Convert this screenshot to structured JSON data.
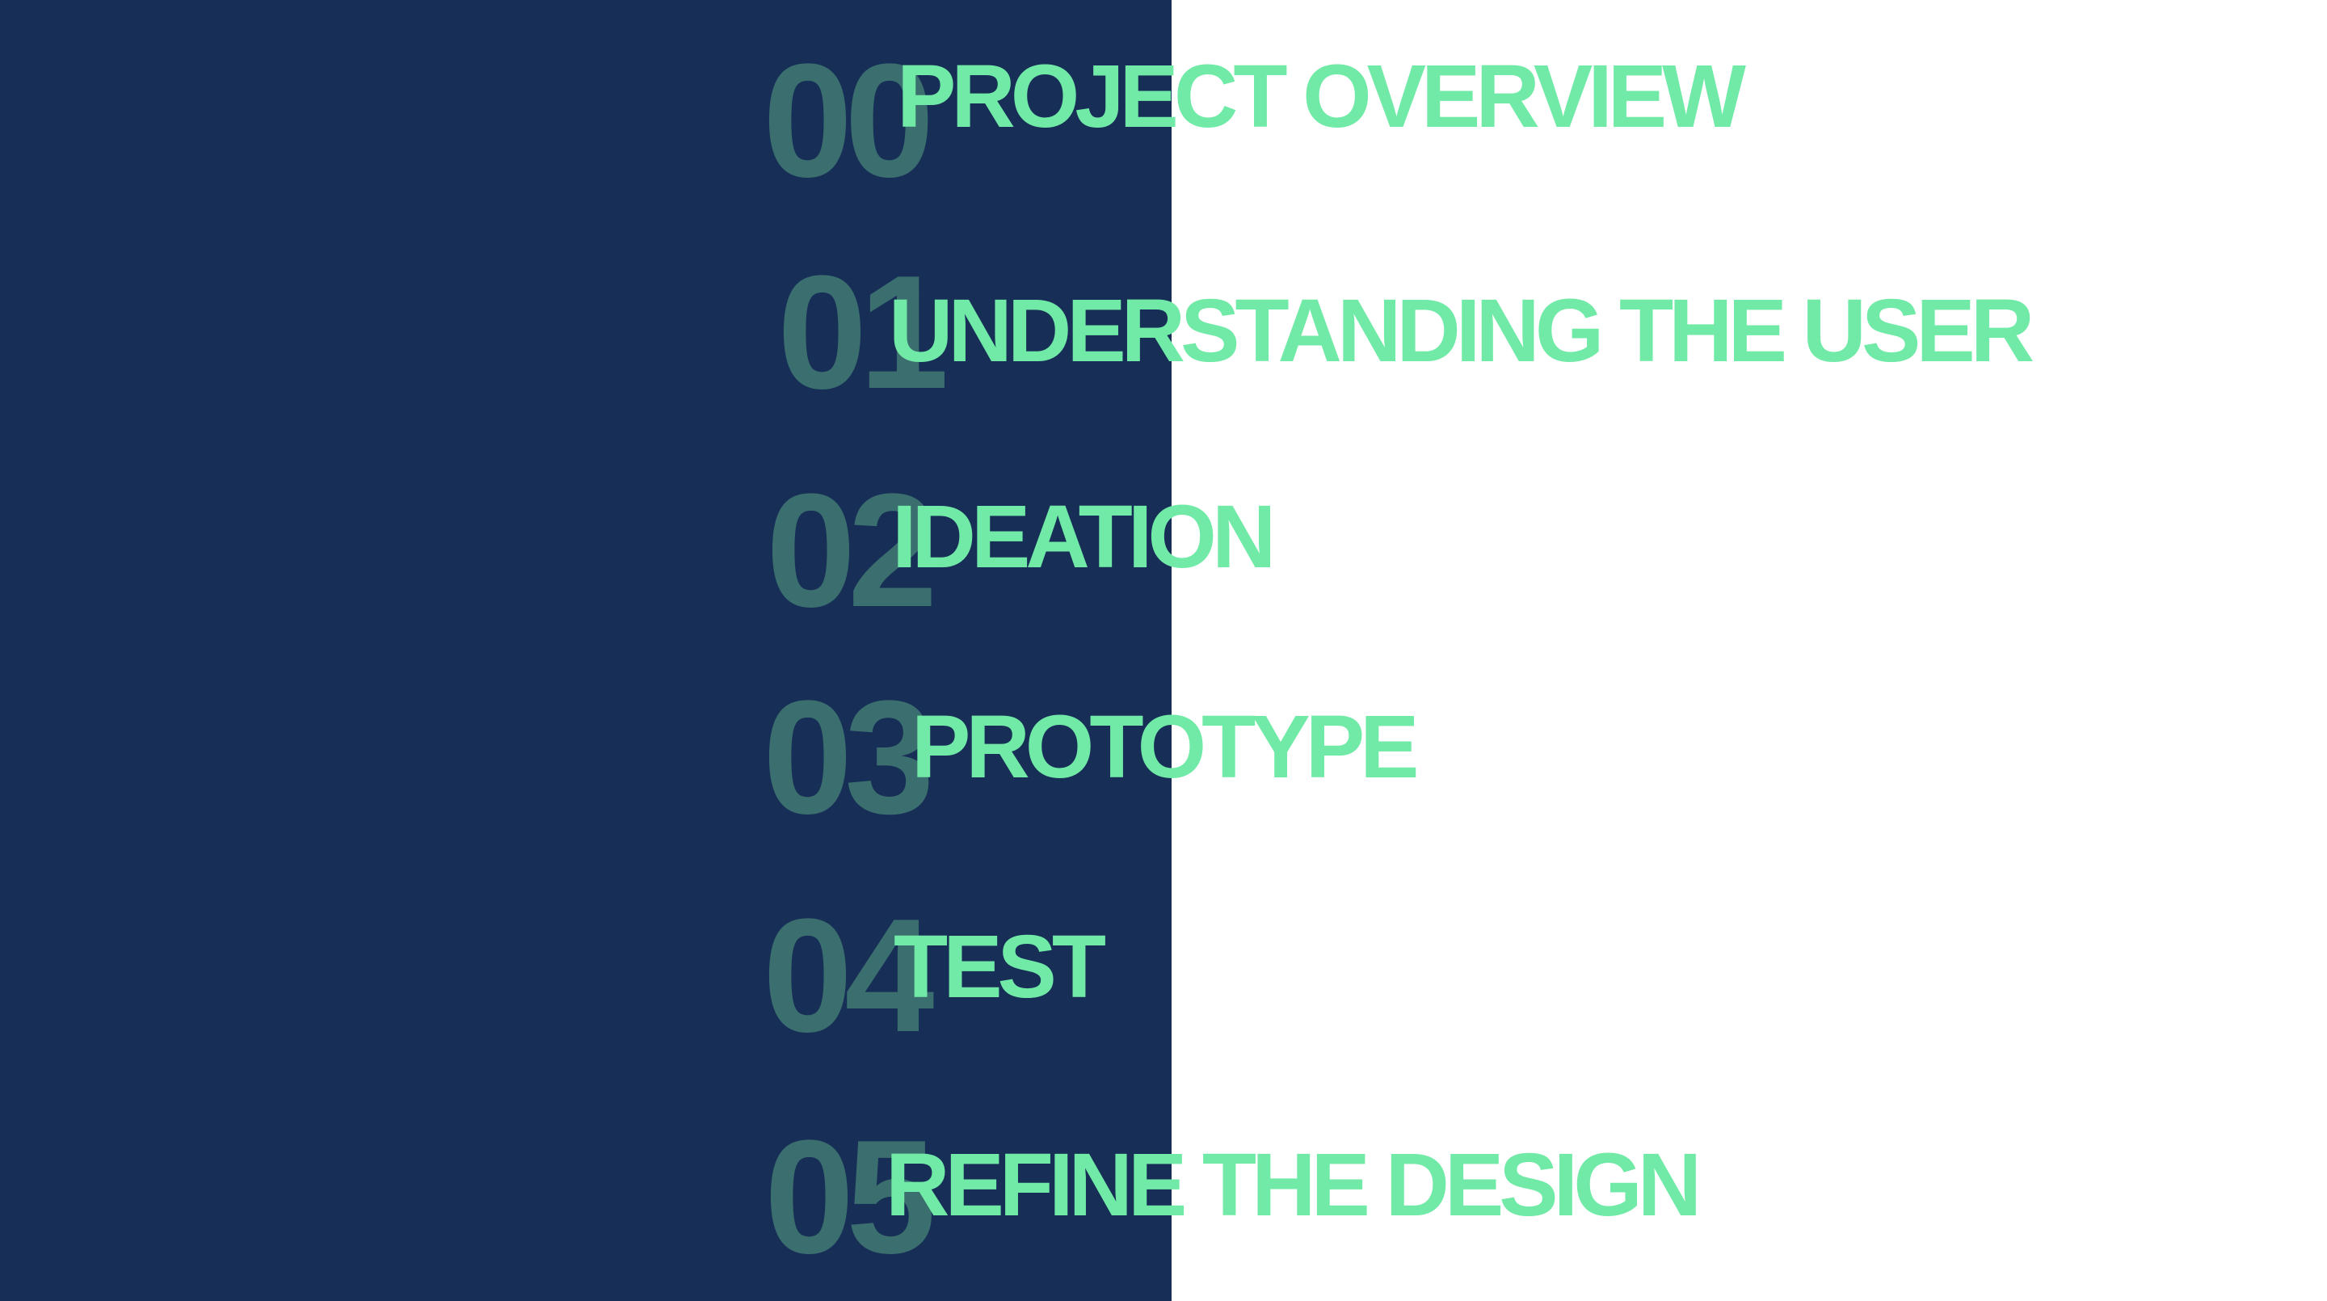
{
  "colors": {
    "panel": "#172f57",
    "background": "#ffffff",
    "number": "#3b6e6e",
    "title": "#71eaa7"
  },
  "agenda": [
    {
      "number": "00",
      "title": "PROJECT OVERVIEW"
    },
    {
      "number": "01",
      "title": "UNDERSTANDING THE USER"
    },
    {
      "number": "02",
      "title": "IDEATION"
    },
    {
      "number": "03",
      "title": "PROTOTYPE"
    },
    {
      "number": "04",
      "title": "TEST"
    },
    {
      "number": "05",
      "title": "REFINE THE DESIGN"
    }
  ]
}
